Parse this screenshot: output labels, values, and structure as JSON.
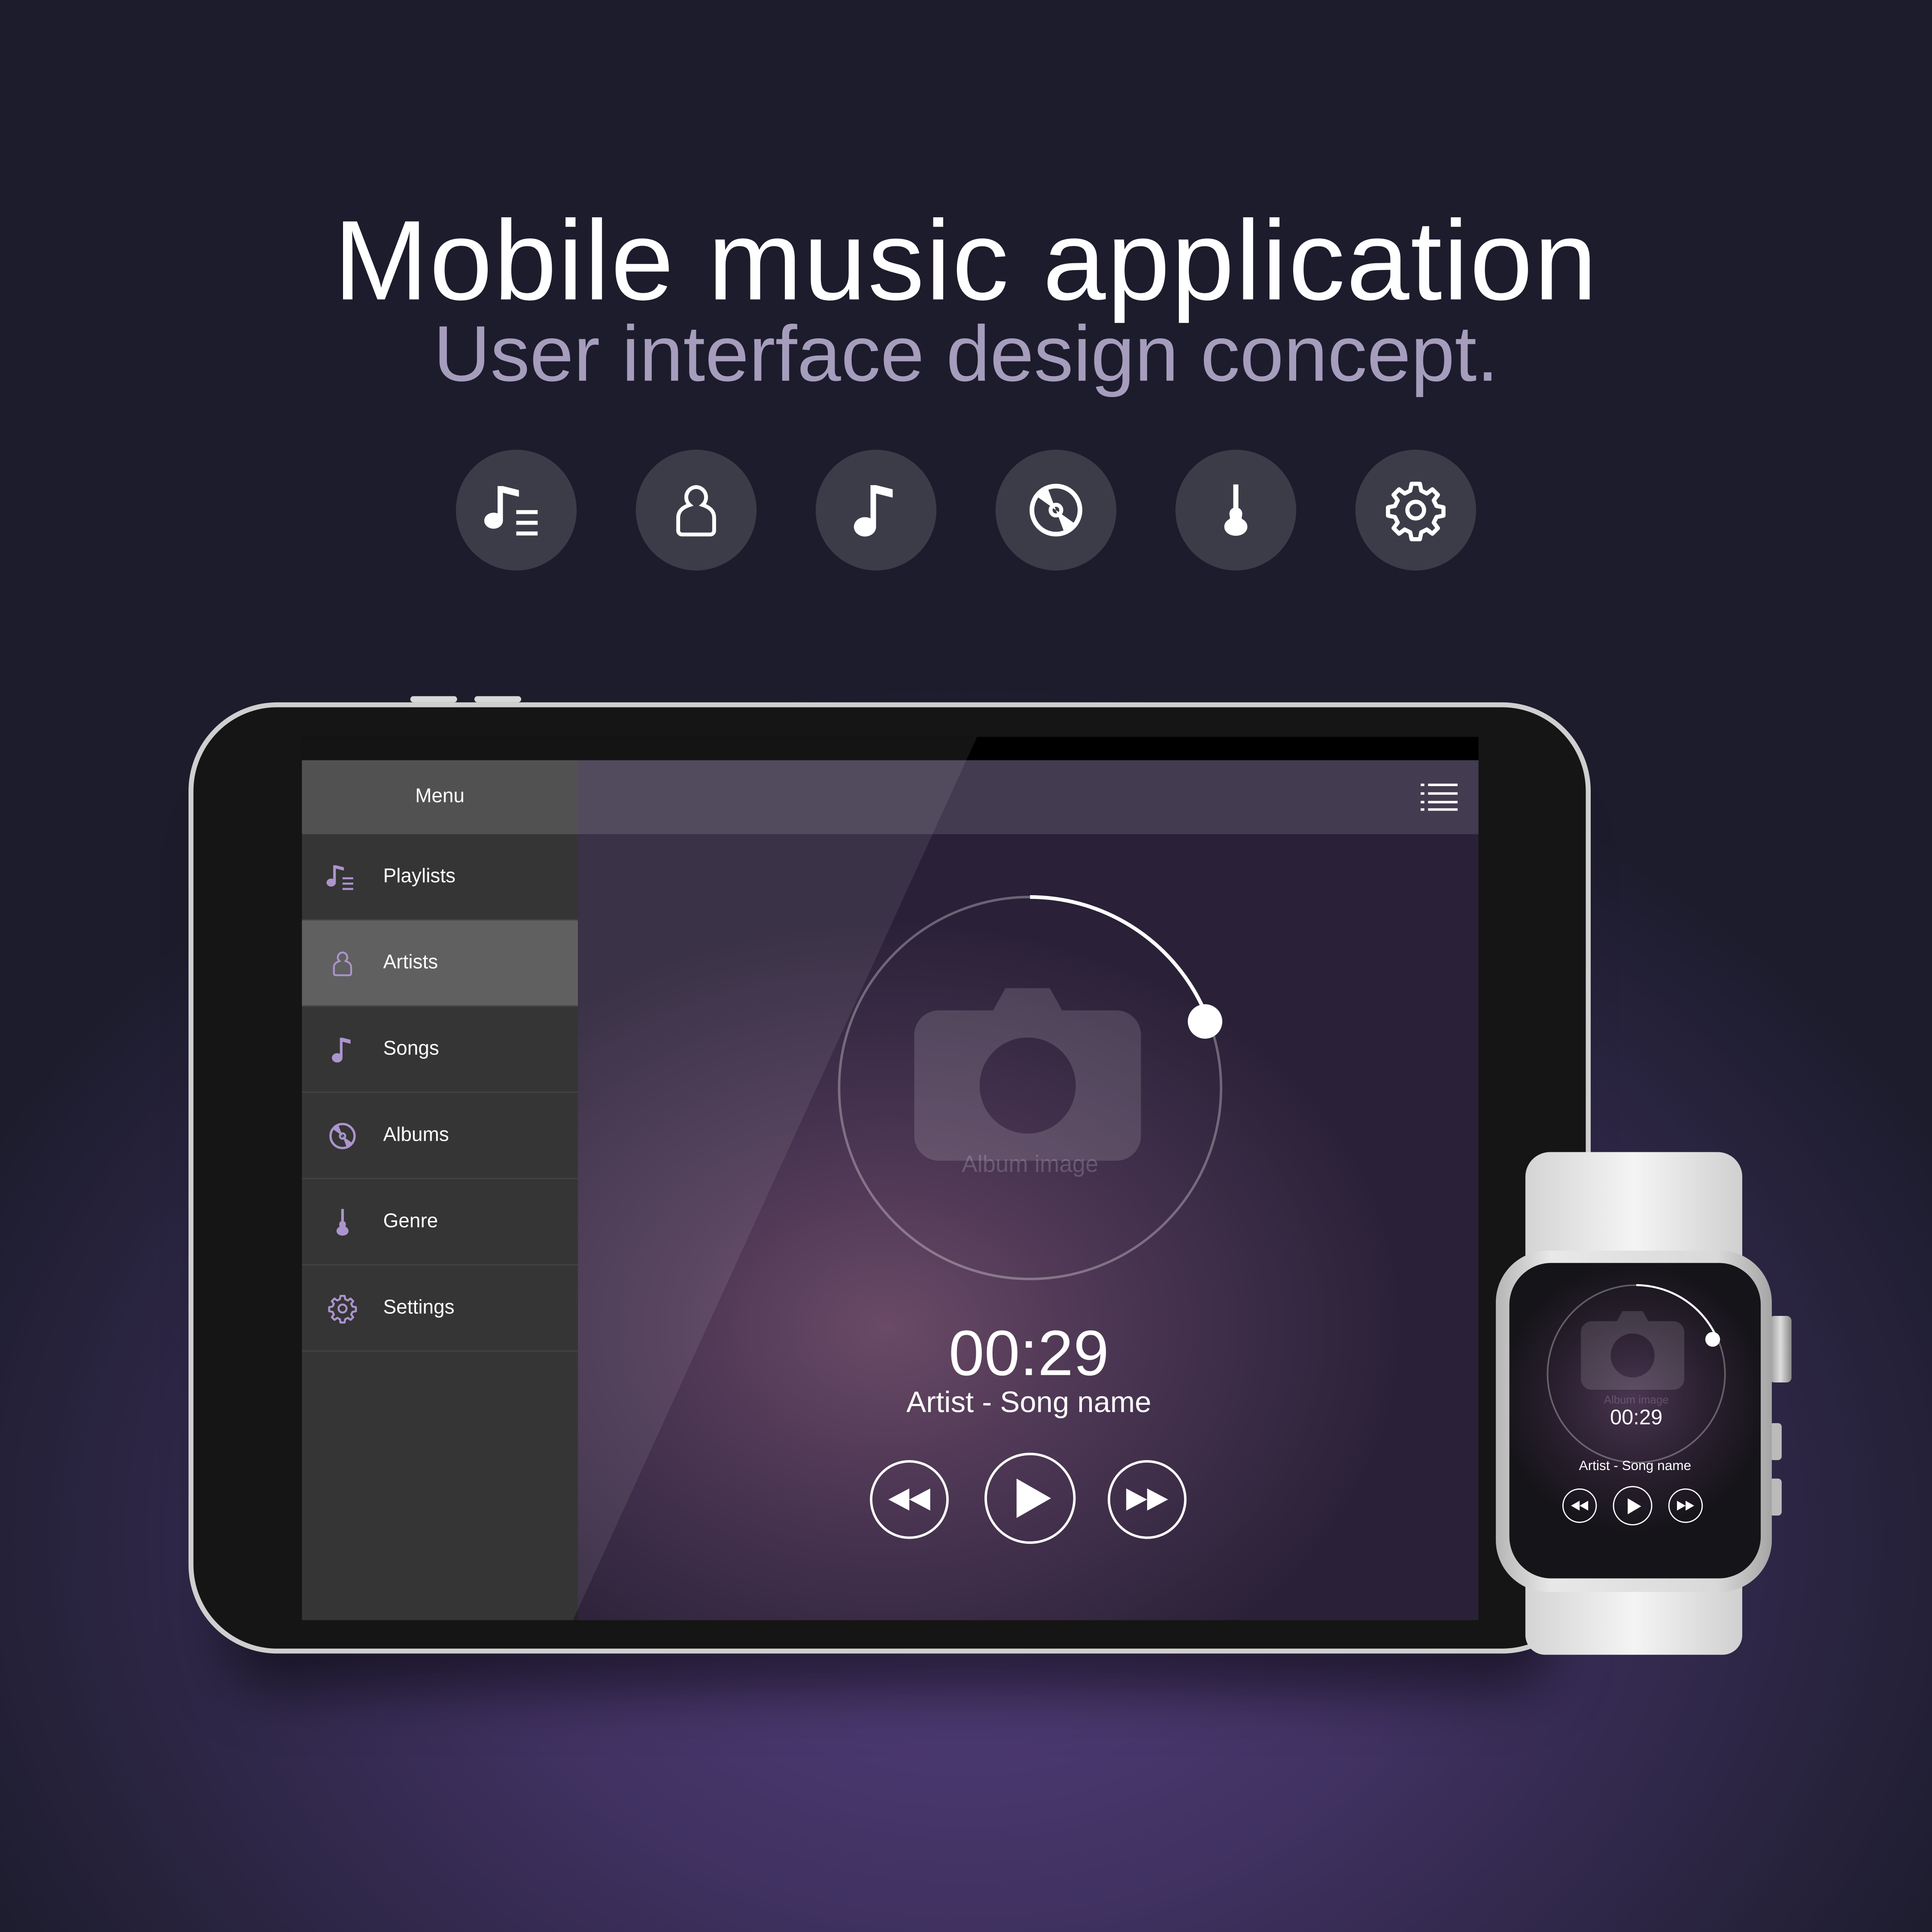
{
  "header": {
    "title": "Mobile music application",
    "subtitle": "User interface design concept."
  },
  "feature_icons": [
    "playlist-icon",
    "artist-icon",
    "music-note-icon",
    "album-disc-icon",
    "guitar-icon",
    "gear-icon"
  ],
  "tablet": {
    "menu_title": "Menu",
    "menu_items": [
      {
        "label": "Playlists",
        "icon": "playlist-icon"
      },
      {
        "label": "Artists",
        "icon": "artist-icon",
        "active": true
      },
      {
        "label": "Songs",
        "icon": "music-note-icon"
      },
      {
        "label": "Albums",
        "icon": "album-disc-icon"
      },
      {
        "label": "Genre",
        "icon": "guitar-icon"
      },
      {
        "label": "Settings",
        "icon": "gear-icon"
      }
    ],
    "player": {
      "album_placeholder": "Album image",
      "time": "00:29",
      "track": "Artist - Song name",
      "progress": 0.17
    }
  },
  "watch": {
    "album_placeholder": "Album image",
    "time": "00:29",
    "track": "Artist - Song name",
    "progress": 0.17
  },
  "colors": {
    "accent": "#a58bc9",
    "menu_bg": "#242424",
    "menu_active": "#535353",
    "menu_header": "#434343"
  }
}
